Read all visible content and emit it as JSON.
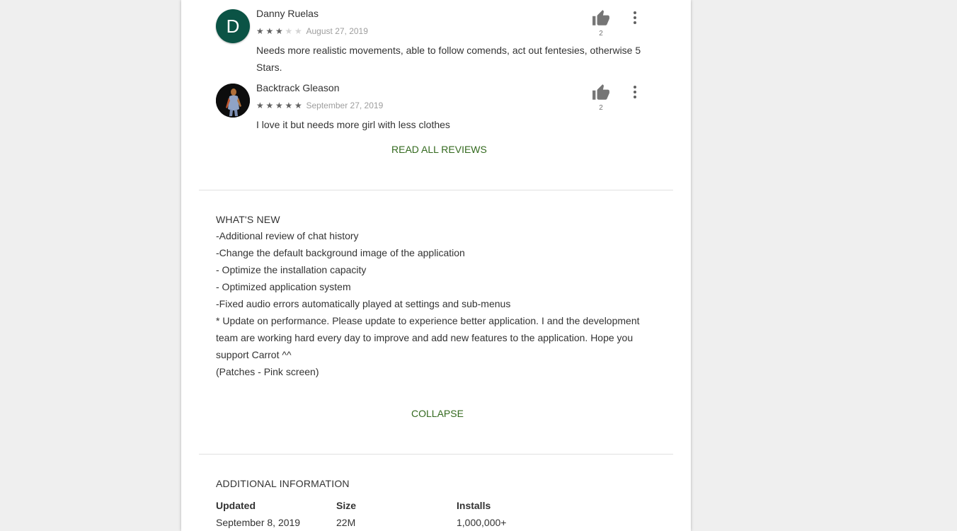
{
  "reviews": [
    {
      "author": "Danny Ruelas",
      "avatar_letter": "D",
      "rating": 3,
      "date": "August 27, 2019",
      "text": "Needs more realistic movements, able to follow comends, act out fentesies, otherwise 5 Stars.",
      "helpful_count": "2"
    },
    {
      "author": "Backtrack Gleason",
      "rating": 5,
      "date": "September 27, 2019",
      "text": "I love it but needs more girl with less clothes",
      "helpful_count": "2"
    }
  ],
  "read_all_label": "READ ALL REVIEWS",
  "whats_new": {
    "title": "WHAT'S NEW",
    "lines": [
      "-Additional review of chat history",
      "-Change the default background image of the application",
      "- Optimize the installation capacity",
      "- Optimized application system",
      "-Fixed audio errors automatically played at settings and sub-menus",
      "* Update on performance. Please update to experience better application. I and the development team are working hard every day to improve and add new features to the application. Hope you support Carrot ^^",
      "(Patches - Pink screen)"
    ],
    "collapse_label": "COLLAPSE"
  },
  "additional_info": {
    "title": "ADDITIONAL INFORMATION",
    "items": [
      {
        "label": "Updated",
        "value": "September 8, 2019"
      },
      {
        "label": "Size",
        "value": "22M"
      },
      {
        "label": "Installs",
        "value": "1,000,000+"
      }
    ]
  },
  "colors": {
    "accent_green": "#33691e",
    "avatar_green": "#0b5345",
    "star_on": "#616161",
    "star_off": "#d4d4d4"
  },
  "icons": {
    "helpful": "thumb-up-icon",
    "more": "more-vert-icon",
    "star": "star-icon"
  }
}
